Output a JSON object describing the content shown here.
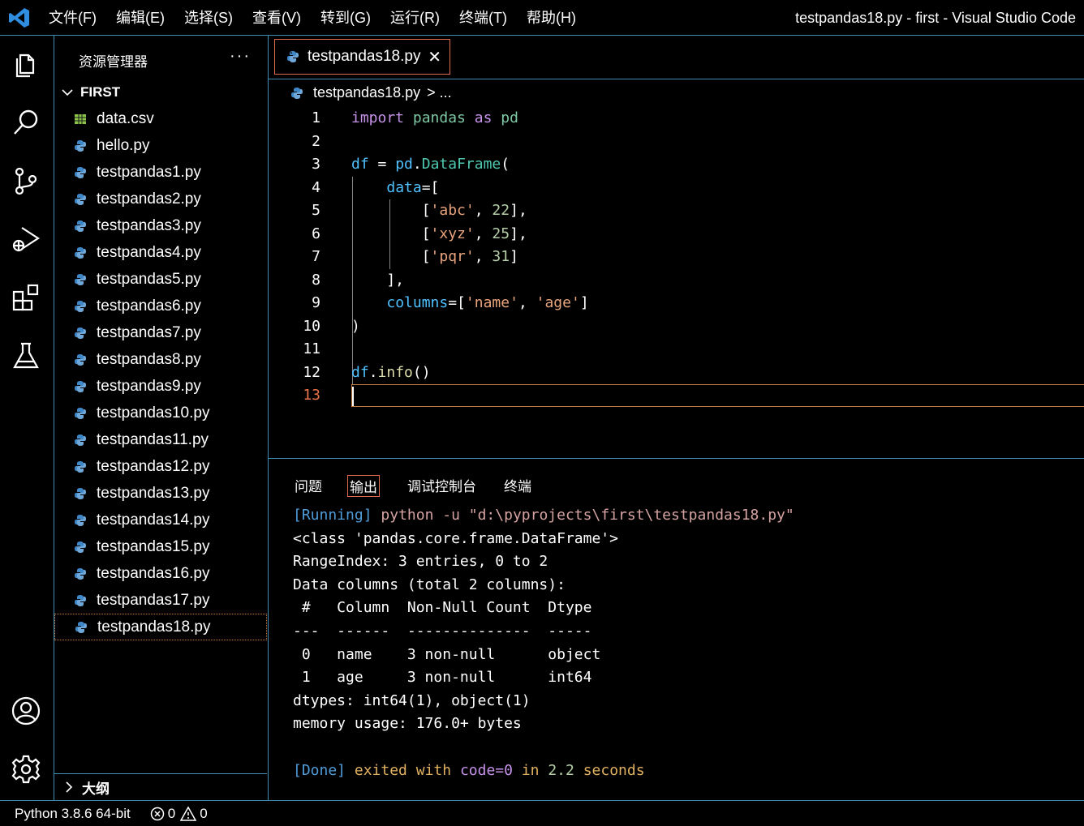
{
  "titlebar": {
    "menu": [
      "文件(F)",
      "编辑(E)",
      "选择(S)",
      "查看(V)",
      "转到(G)",
      "运行(R)",
      "终端(T)",
      "帮助(H)"
    ],
    "window_title": "testpandas18.py - first - Visual Studio Code"
  },
  "sidebar": {
    "title": "资源管理器",
    "more": "···",
    "folder": "FIRST",
    "files": [
      "data.csv",
      "hello.py",
      "testpandas1.py",
      "testpandas2.py",
      "testpandas3.py",
      "testpandas4.py",
      "testpandas5.py",
      "testpandas6.py",
      "testpandas7.py",
      "testpandas8.py",
      "testpandas9.py",
      "testpandas10.py",
      "testpandas11.py",
      "testpandas12.py",
      "testpandas13.py",
      "testpandas14.py",
      "testpandas15.py",
      "testpandas16.py",
      "testpandas17.py",
      "testpandas18.py"
    ],
    "outline": "大纲"
  },
  "editor": {
    "tab_label": "testpandas18.py",
    "tab_close": "✕",
    "breadcrumb_file": "testpandas18.py",
    "breadcrumb_rest": "> ...",
    "line_numbers": [
      "1",
      "2",
      "3",
      "4",
      "5",
      "6",
      "7",
      "8",
      "9",
      "10",
      "11",
      "12",
      "13"
    ]
  },
  "panel": {
    "tabs": [
      "问题",
      "输出",
      "调试控制台",
      "终端"
    ],
    "output_lines": [
      "<class 'pandas.core.frame.DataFrame'>",
      "RangeIndex: 3 entries, 0 to 2",
      "Data columns (total 2 columns):",
      " #   Column  Non-Null Count  Dtype ",
      "---  ------  --------------  ----- ",
      " 0   name    3 non-null      object",
      " 1   age     3 non-null      int64 ",
      "dtypes: int64(1), object(1)",
      "memory usage: 176.0+ bytes"
    ],
    "run_tag": "[Running]",
    "run_cmd": "python -u \"d:\\pyprojects\\first\\testpandas18.py\"",
    "done_tag": "[Done]",
    "done_text": "exited with",
    "done_code": "code=0",
    "done_in": "in",
    "done_time": "2.2",
    "done_unit": "seconds"
  },
  "status": {
    "python": "Python 3.8.6 64-bit",
    "errors": "0",
    "warnings": "0"
  },
  "colors": {
    "accent_border": "#3c8cb4",
    "tab_border": "#e06c4c",
    "keyword": "#c792ea",
    "string": "#e8a47c"
  }
}
